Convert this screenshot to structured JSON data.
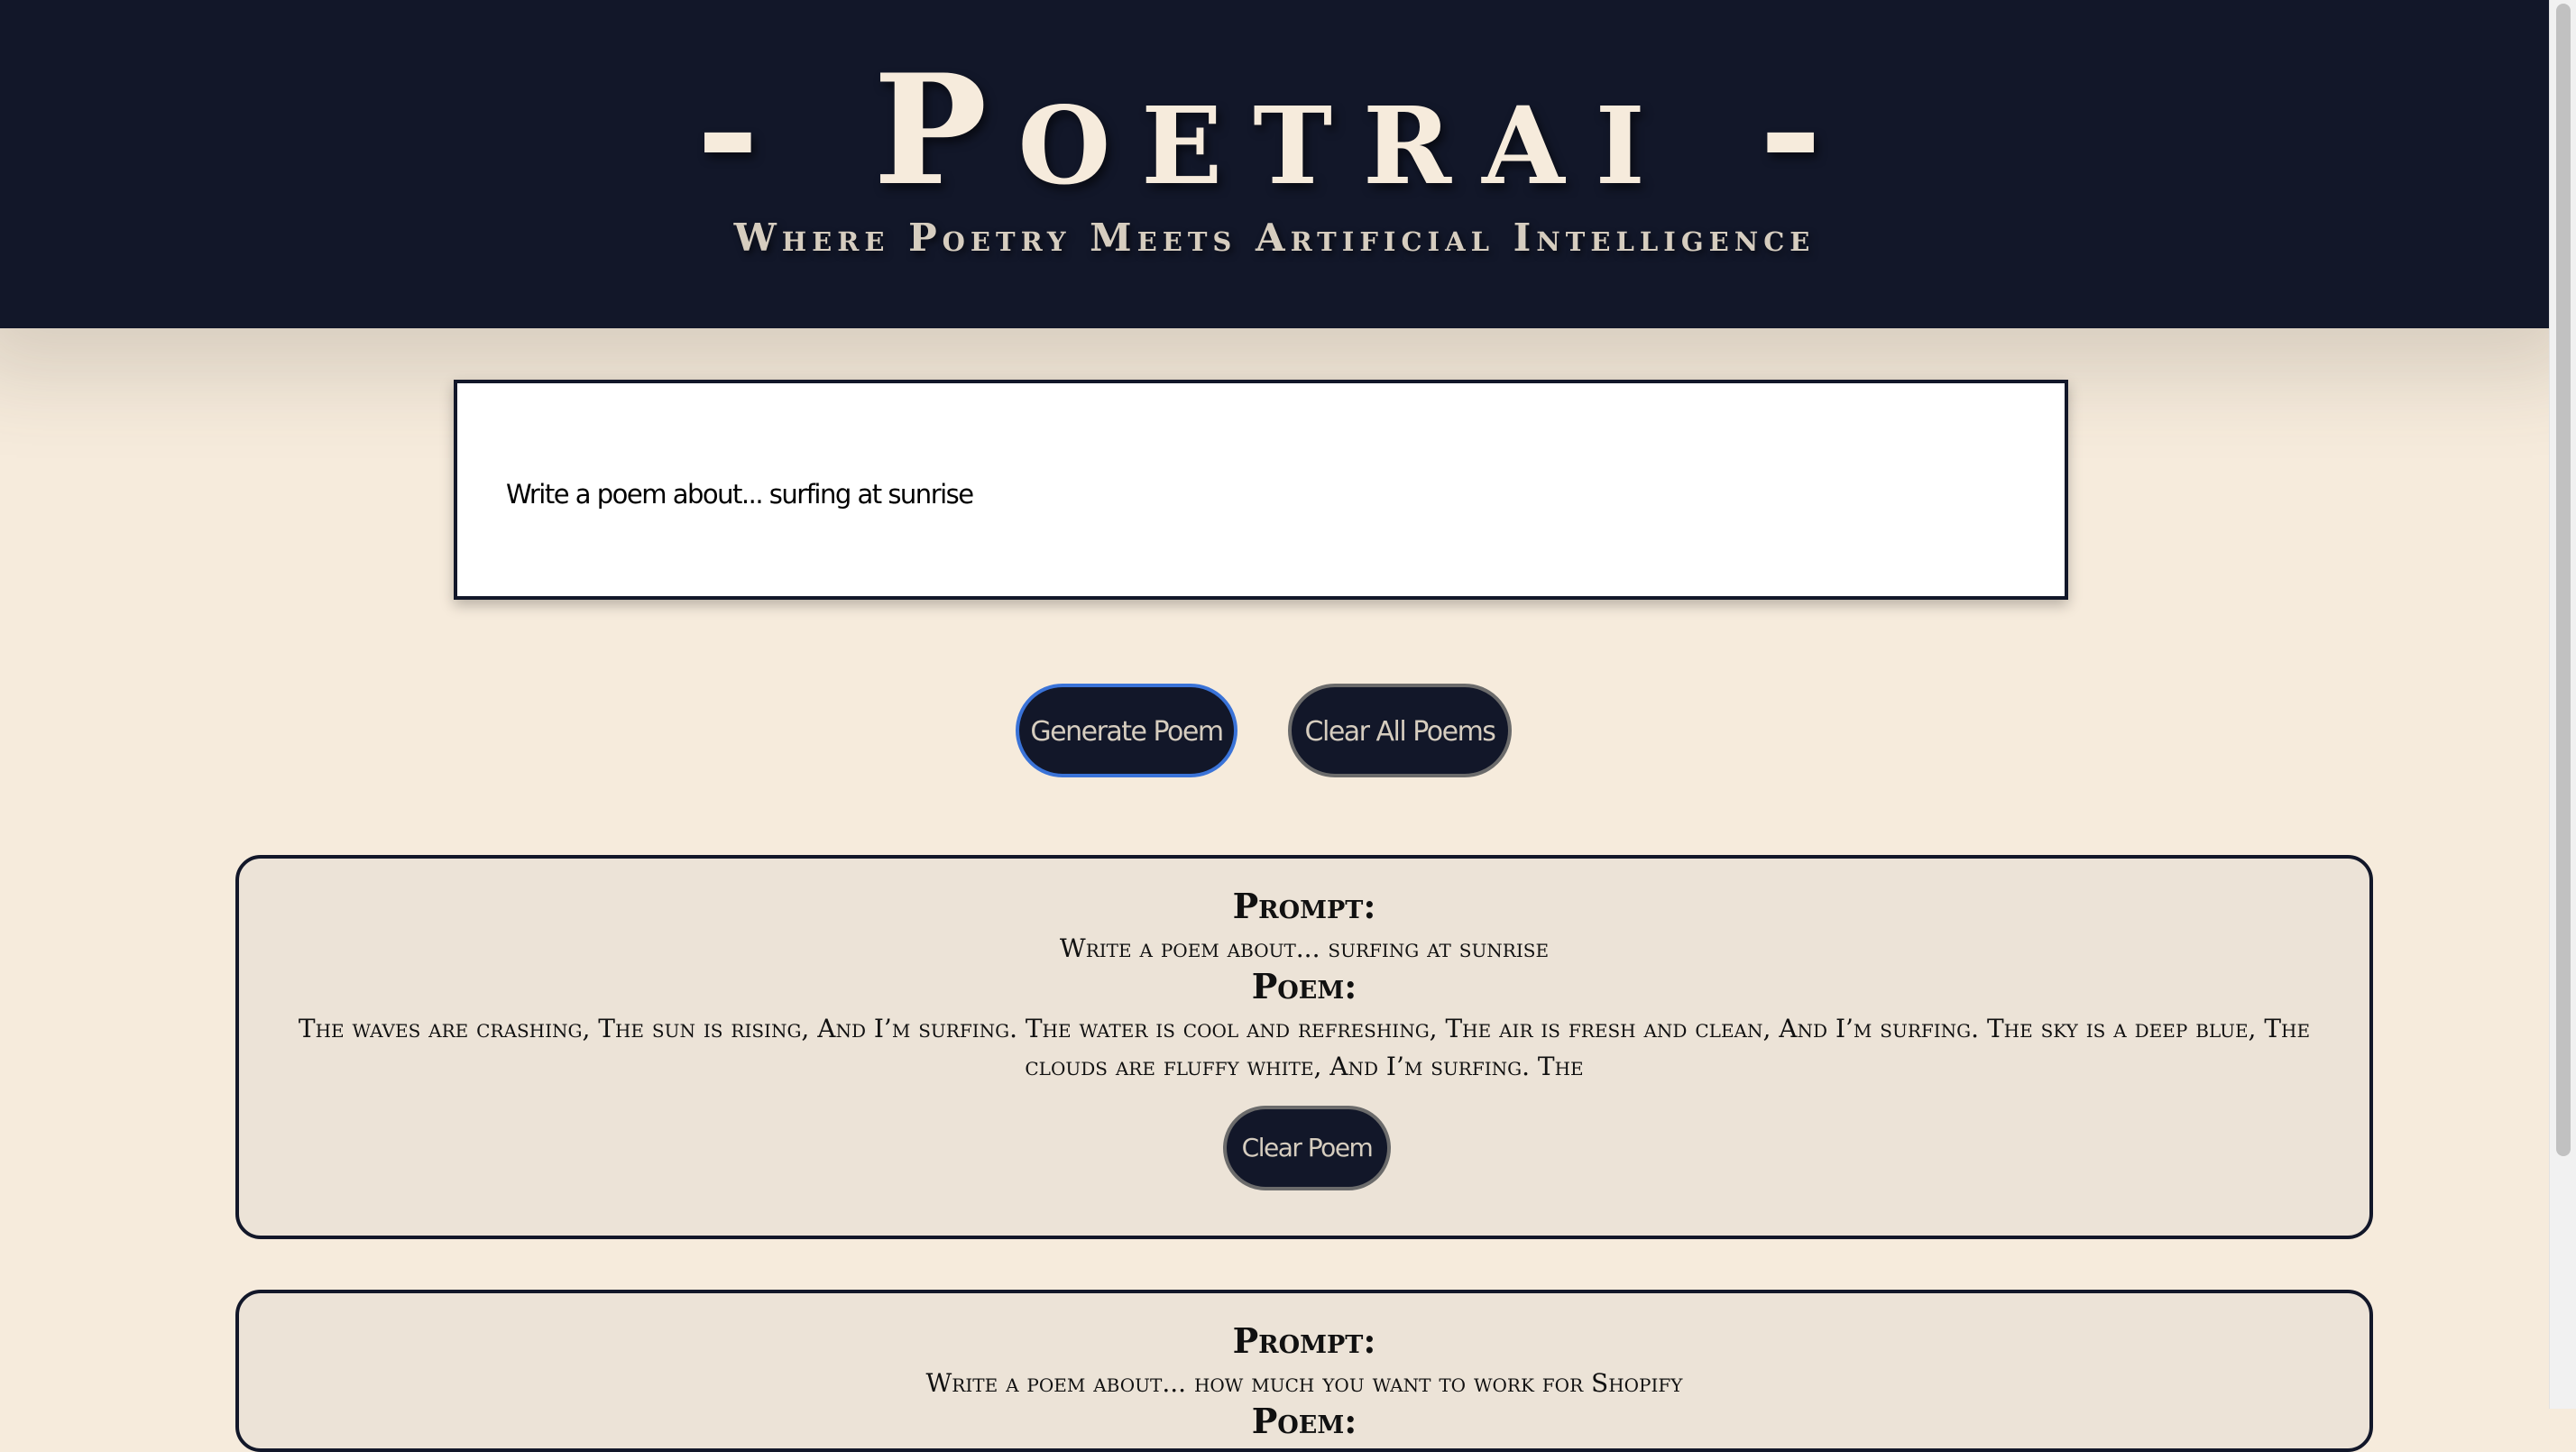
{
  "header": {
    "title": "- Poetrai -",
    "subtitle": "Where Poetry Meets Artificial Intelligence"
  },
  "prompt_input": {
    "value": "Write a poem about... surfing at sunrise"
  },
  "actions": {
    "generate_label": "Generate Poem",
    "clear_all_label": "Clear All Poems"
  },
  "poems": [
    {
      "prompt_label": "Prompt:",
      "prompt": "Write a poem about... surfing at sunrise",
      "poem_label": "Poem:",
      "poem": "The waves are crashing, The sun is rising, And I’m surfing. The water is cool and refreshing, The air is fresh and clean, And I’m surfing. The sky is a deep blue, The clouds are fluffy white, And I’m surfing. The",
      "clear_label": "Clear Poem"
    },
    {
      "prompt_label": "Prompt:",
      "prompt": "Write a poem about... how much you want to work for Shopify",
      "poem_label": "Poem:"
    }
  ],
  "colors": {
    "header_bg": "#121729",
    "page_bg": "#f6ebdc",
    "card_bg": "#ece3d7",
    "accent_focus": "#3a73d8"
  }
}
